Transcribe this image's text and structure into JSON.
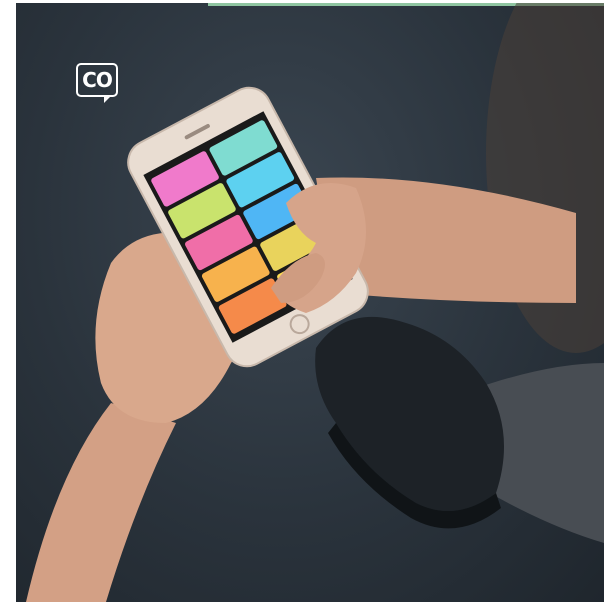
{
  "logo": {
    "text": "CO"
  },
  "colors": {
    "background_floor": "#2c353e",
    "accent_strip": "#8fc5a1",
    "skin": "#d9a88c",
    "phone_frame": "#e9ddd2",
    "shoe": "#1c2126",
    "pants": "#43484d"
  },
  "phone_tiles": [
    {
      "label": "",
      "color": "#f07acb"
    },
    {
      "label": "",
      "color": "#7fdcd1"
    },
    {
      "label": "",
      "color": "#c9e36d"
    },
    {
      "label": "",
      "color": "#5dd1f0"
    },
    {
      "label": "",
      "color": "#f06ea8"
    },
    {
      "label": "",
      "color": "#4fb6f5"
    },
    {
      "label": "",
      "color": "#f7b24d"
    },
    {
      "label": "",
      "color": "#e9d35c"
    },
    {
      "label": "",
      "color": "#f58a4a"
    },
    {
      "label": "",
      "color": "#ffdd55"
    }
  ]
}
